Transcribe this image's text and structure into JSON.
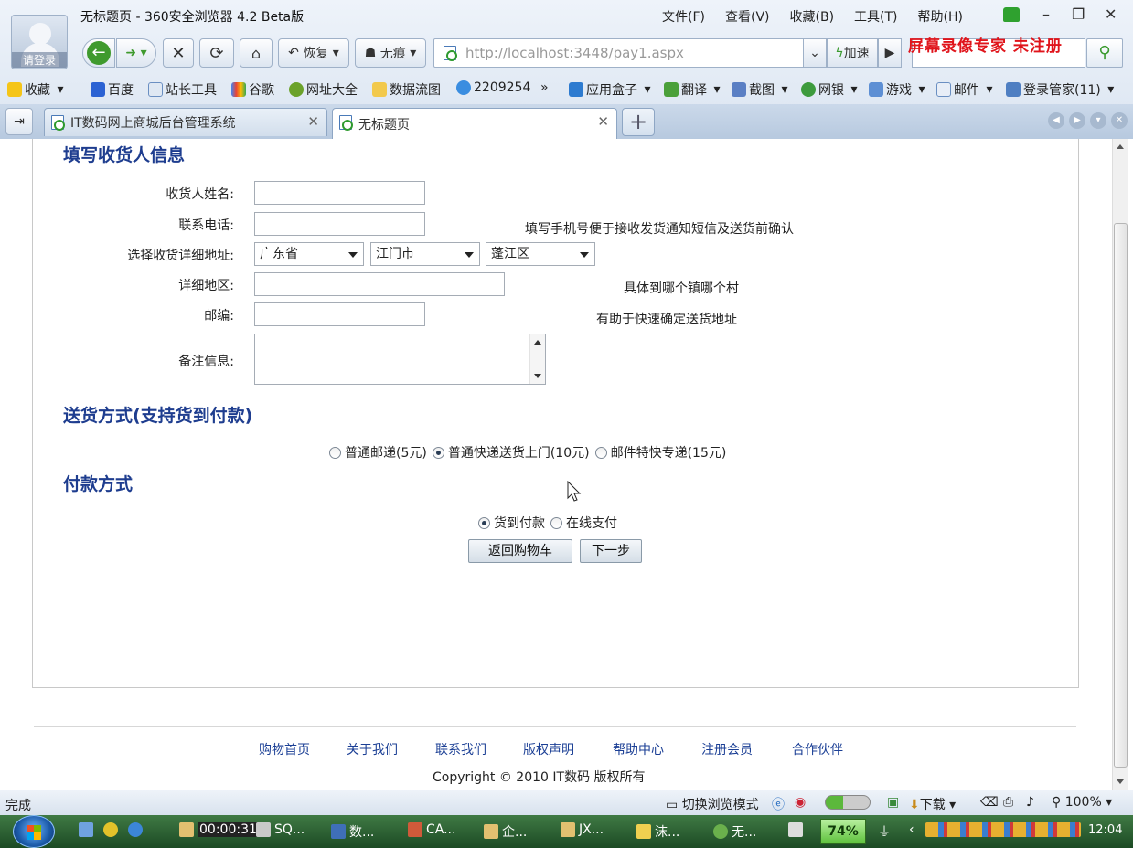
{
  "window": {
    "title": "无标题页 - 360安全浏览器 4.2 Beta版",
    "login_label": "请登录",
    "menu": [
      "文件(F)",
      "查看(V)",
      "收藏(B)",
      "工具(T)",
      "帮助(H)"
    ]
  },
  "toolbar": {
    "restore_label": "恢复",
    "incognito_label": "无痕",
    "url_host": "http://localhost",
    "url_rest": ":3448/pay1.aspx",
    "speed_label": "加速",
    "recorder_watermark": "屏幕录像专家  未注册"
  },
  "favorites": [
    {
      "label": "收藏",
      "icon": "star-icon"
    },
    {
      "label": "百度",
      "icon": "baidu-icon"
    },
    {
      "label": "站长工具",
      "icon": "page-icon"
    },
    {
      "label": "谷歌",
      "icon": "google-icon"
    },
    {
      "label": "网址大全",
      "icon": "add-icon"
    },
    {
      "label": "数据流图",
      "icon": "folder-icon"
    },
    {
      "label": "2209254",
      "icon": "qq-icon"
    },
    {
      "label": "»",
      "icon": ""
    },
    {
      "label": "应用盒子",
      "icon": "box-icon"
    },
    {
      "label": "翻译",
      "icon": "translate-icon"
    },
    {
      "label": "截图",
      "icon": "scissors-icon"
    },
    {
      "label": "网银",
      "icon": "bank-icon"
    },
    {
      "label": "游戏",
      "icon": "game-icon"
    },
    {
      "label": "邮件",
      "icon": "mail-icon"
    },
    {
      "label": "登录管家(11)",
      "icon": "key-icon"
    }
  ],
  "tabs": [
    {
      "label": "IT数码网上商城后台管理系统",
      "active": false
    },
    {
      "label": "无标题页",
      "active": true
    }
  ],
  "form": {
    "section_receiver": "填写收货人信息",
    "name_label": "收货人姓名:",
    "phone_label": "联系电话:",
    "phone_hint": "填写手机号便于接收发货通知短信及送货前确认",
    "region_label": "选择收货详细地址:",
    "province": "广东省",
    "city": "江门市",
    "district": "蓬江区",
    "detail_label": "详细地区:",
    "detail_hint": "具体到哪个镇哪个村",
    "zip_label": "邮编:",
    "zip_hint": "有助于快速确定送货地址",
    "note_label": "备注信息:",
    "section_shipping": "送货方式(支持货到付款)",
    "shipping_options": [
      {
        "label": "普通邮递(5元)",
        "checked": false
      },
      {
        "label": "普通快递送货上门(10元)",
        "checked": true
      },
      {
        "label": "邮件特快专递(15元)",
        "checked": false
      }
    ],
    "section_payment": "付款方式",
    "payment_options": [
      {
        "label": "货到付款",
        "checked": true
      },
      {
        "label": "在线支付",
        "checked": false
      }
    ],
    "back_button": "返回购物车",
    "next_button": "下一步"
  },
  "footer": {
    "links": [
      "购物首页",
      "关于我们",
      "联系我们",
      "版权声明",
      "帮助中心",
      "注册会员",
      "合作伙伴"
    ],
    "copyright": "Copyright © 2010 IT数码 版权所有"
  },
  "statusbar": {
    "status": "完成",
    "switch_mode": "切换浏览模式",
    "download": "下载",
    "zoom": "100%"
  },
  "taskbar": {
    "items": [
      "00:00:31",
      "SQ...",
      "数...",
      "CA...",
      "企...",
      "JX...",
      "沫...",
      "无..."
    ],
    "battery": "74%",
    "clock": "12:04"
  },
  "colors": {
    "section_title": "#1e3d8f",
    "footer_link": "#1b3f95",
    "recorder_red": "#e0141b"
  }
}
